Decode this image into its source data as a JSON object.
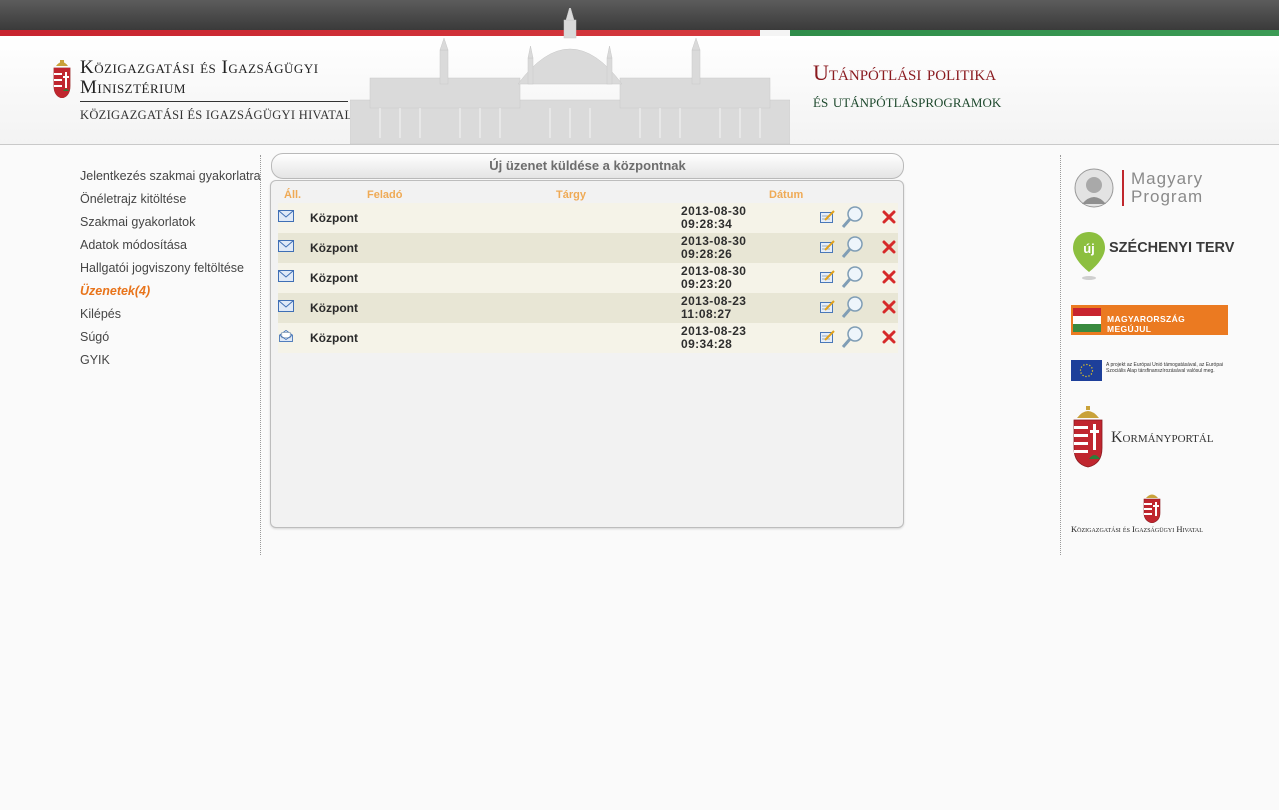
{
  "header": {
    "ministry_title_line1": "Közigazgatási és Igazságügyi",
    "ministry_title_line2": "Minisztérium",
    "ministry_subtitle": "KÖZIGAZGATÁSI ÉS IGAZSÁGÜGYI HIVATAL",
    "program_line1": "Utánpótlási politika",
    "program_line2": "és utánpótlásprogramok"
  },
  "sidebar": {
    "items": [
      {
        "label": "Jelentkezés szakmai gyakorlatra"
      },
      {
        "label": "Önéletrajz kitöltése"
      },
      {
        "label": "Szakmai gyakorlatok"
      },
      {
        "label": "Adatok módosítása"
      },
      {
        "label": "Hallgatói jogviszony feltöltése"
      },
      {
        "label": "Üzenetek(4)",
        "active": true
      },
      {
        "label": "Kilépés"
      },
      {
        "label": "Súgó"
      },
      {
        "label": "GYIK"
      }
    ]
  },
  "main": {
    "compose_button": "Új üzenet küldése a központnak",
    "columns": {
      "status": "Áll.",
      "sender": "Feladó",
      "subject": "Tárgy",
      "date": "Dátum"
    },
    "messages": [
      {
        "status_icon": "envelope-closed-icon",
        "sender": "Központ",
        "subject": "",
        "date": "2013-08-30",
        "time": "09:28:34"
      },
      {
        "status_icon": "envelope-closed-icon",
        "sender": "Központ",
        "subject": "",
        "date": "2013-08-30",
        "time": "09:28:26"
      },
      {
        "status_icon": "envelope-closed-icon",
        "sender": "Központ",
        "subject": "",
        "date": "2013-08-30",
        "time": "09:23:20"
      },
      {
        "status_icon": "envelope-closed-icon",
        "sender": "Központ",
        "subject": "",
        "date": "2013-08-23",
        "time": "11:08:27"
      },
      {
        "status_icon": "envelope-open-icon",
        "sender": "Központ",
        "subject": "",
        "date": "2013-08-23",
        "time": "09:34:28"
      }
    ]
  },
  "logos": {
    "magyary_line1": "Magyary",
    "magyary_line2": "Program",
    "szechenyi_letter": "új",
    "szechenyi": "SZÉCHENYI TERV",
    "megujul": "MAGYARORSZÁG MEGÚJUL",
    "eu_text": "A projekt az Európai Unió támogatásával, az Európai Szociális Alap társfinanszírozásával valósul meg.",
    "kormanyportal": "Kormányportál",
    "kih": "Közigazgatási és Igazságügyi Hivatal"
  },
  "colors": {
    "active_nav": "#e8741b",
    "column_header": "#efaa55",
    "stripe_red": "#c8242f",
    "stripe_green": "#2f8d4a"
  }
}
